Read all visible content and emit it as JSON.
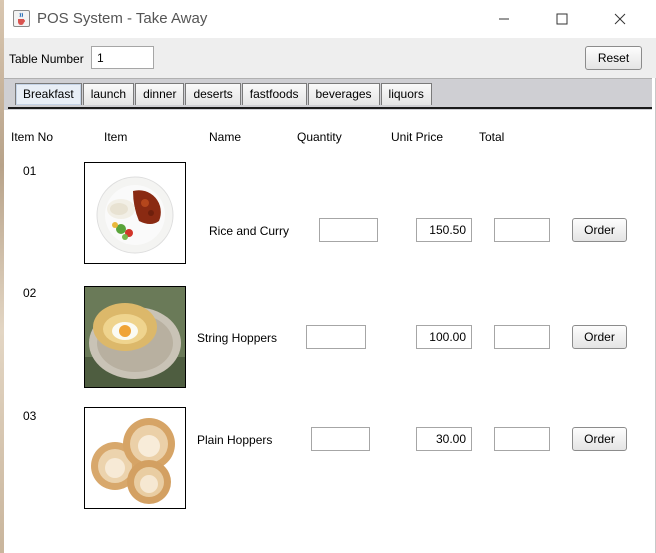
{
  "window": {
    "title": "POS System - Take Away",
    "icon": "java-cup-icon"
  },
  "top": {
    "table_label": "Table Number",
    "table_value": "1",
    "reset_label": "Reset"
  },
  "tabs": [
    {
      "label": "Breakfast",
      "active": true
    },
    {
      "label": "launch"
    },
    {
      "label": "dinner"
    },
    {
      "label": "deserts"
    },
    {
      "label": "fastfoods"
    },
    {
      "label": "beverages"
    },
    {
      "label": "liquors"
    }
  ],
  "headers": {
    "item_no": "Item No",
    "item": "Item",
    "name": "Name",
    "quantity": "Quantity",
    "unit_price": "Unit Price",
    "total": "Total"
  },
  "items": [
    {
      "no": "01",
      "name": "Rice and Curry",
      "quantity": "",
      "unit_price": "150.50",
      "total": "",
      "order_label": "Order"
    },
    {
      "no": "02",
      "name": "String Hoppers",
      "quantity": "",
      "unit_price": "100.00",
      "total": "",
      "order_label": "Order"
    },
    {
      "no": "03",
      "name": "Plain Hoppers",
      "quantity": "",
      "unit_price": "30.00",
      "total": "",
      "order_label": "Order"
    }
  ]
}
